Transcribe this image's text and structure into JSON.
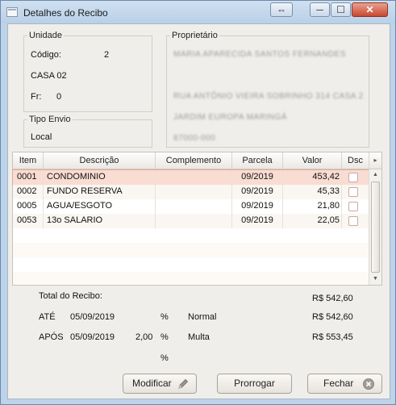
{
  "window": {
    "title": "Detalhes do Recibo",
    "restore_glyph": "⇔",
    "min_glyph": "─",
    "max_glyph": "☐",
    "close_glyph": "✕"
  },
  "unidade": {
    "title": "Unidade",
    "codigo_label": "Código:",
    "codigo_value": "2",
    "unit_name": "CASA 02",
    "fr_label": "Fr:",
    "fr_value": "0"
  },
  "tipo_envio": {
    "title": "Tipo Envio",
    "value": "Local"
  },
  "proprietario": {
    "title": "Proprietário",
    "line1": "MARIA APARECIDA SANTOS FERNANDES",
    "line2": "RUA ANTÔNIO VIEIRA SOBRINHO 314 CASA 2",
    "line3": "JARDIM EUROPA          MARINGÁ",
    "line4": "87000-000"
  },
  "table": {
    "headers": [
      "Item",
      "Descrição",
      "Complemento",
      "Parcela",
      "Valor",
      "Dsc"
    ],
    "scroll_arrow": "▸",
    "rows": [
      {
        "item": "0001",
        "descricao": "CONDOMINIO",
        "complemento": "",
        "parcela": "09/2019",
        "valor": "453,42"
      },
      {
        "item": "0002",
        "descricao": "FUNDO RESERVA",
        "complemento": "",
        "parcela": "09/2019",
        "valor": "45,33"
      },
      {
        "item": "0005",
        "descricao": "AGUA/ESGOTO",
        "complemento": "",
        "parcela": "09/2019",
        "valor": "21,80"
      },
      {
        "item": "0053",
        "descricao": "13o SALARIO",
        "complemento": "",
        "parcela": "09/2019",
        "valor": "22,05"
      }
    ],
    "scroll_up": "▲",
    "scroll_down": "▼"
  },
  "totals": {
    "total_label": "Total do Recibo:",
    "total_value": "R$ 542,60",
    "ate_label": "ATÉ",
    "ate_date": "05/09/2019",
    "ate_pct": "%",
    "ate_type": "Normal",
    "ate_value": "R$ 542,60",
    "apos_label": "APÓS",
    "apos_date": "05/09/2019",
    "apos_rate": "2,00",
    "apos_pct": "%",
    "apos_type": "Multa",
    "apos_value": "R$ 553,45",
    "extra_pct": "%"
  },
  "buttons": {
    "modificar": "Modificar",
    "prorrogar": "Prorrogar",
    "fechar": "Fechar"
  }
}
